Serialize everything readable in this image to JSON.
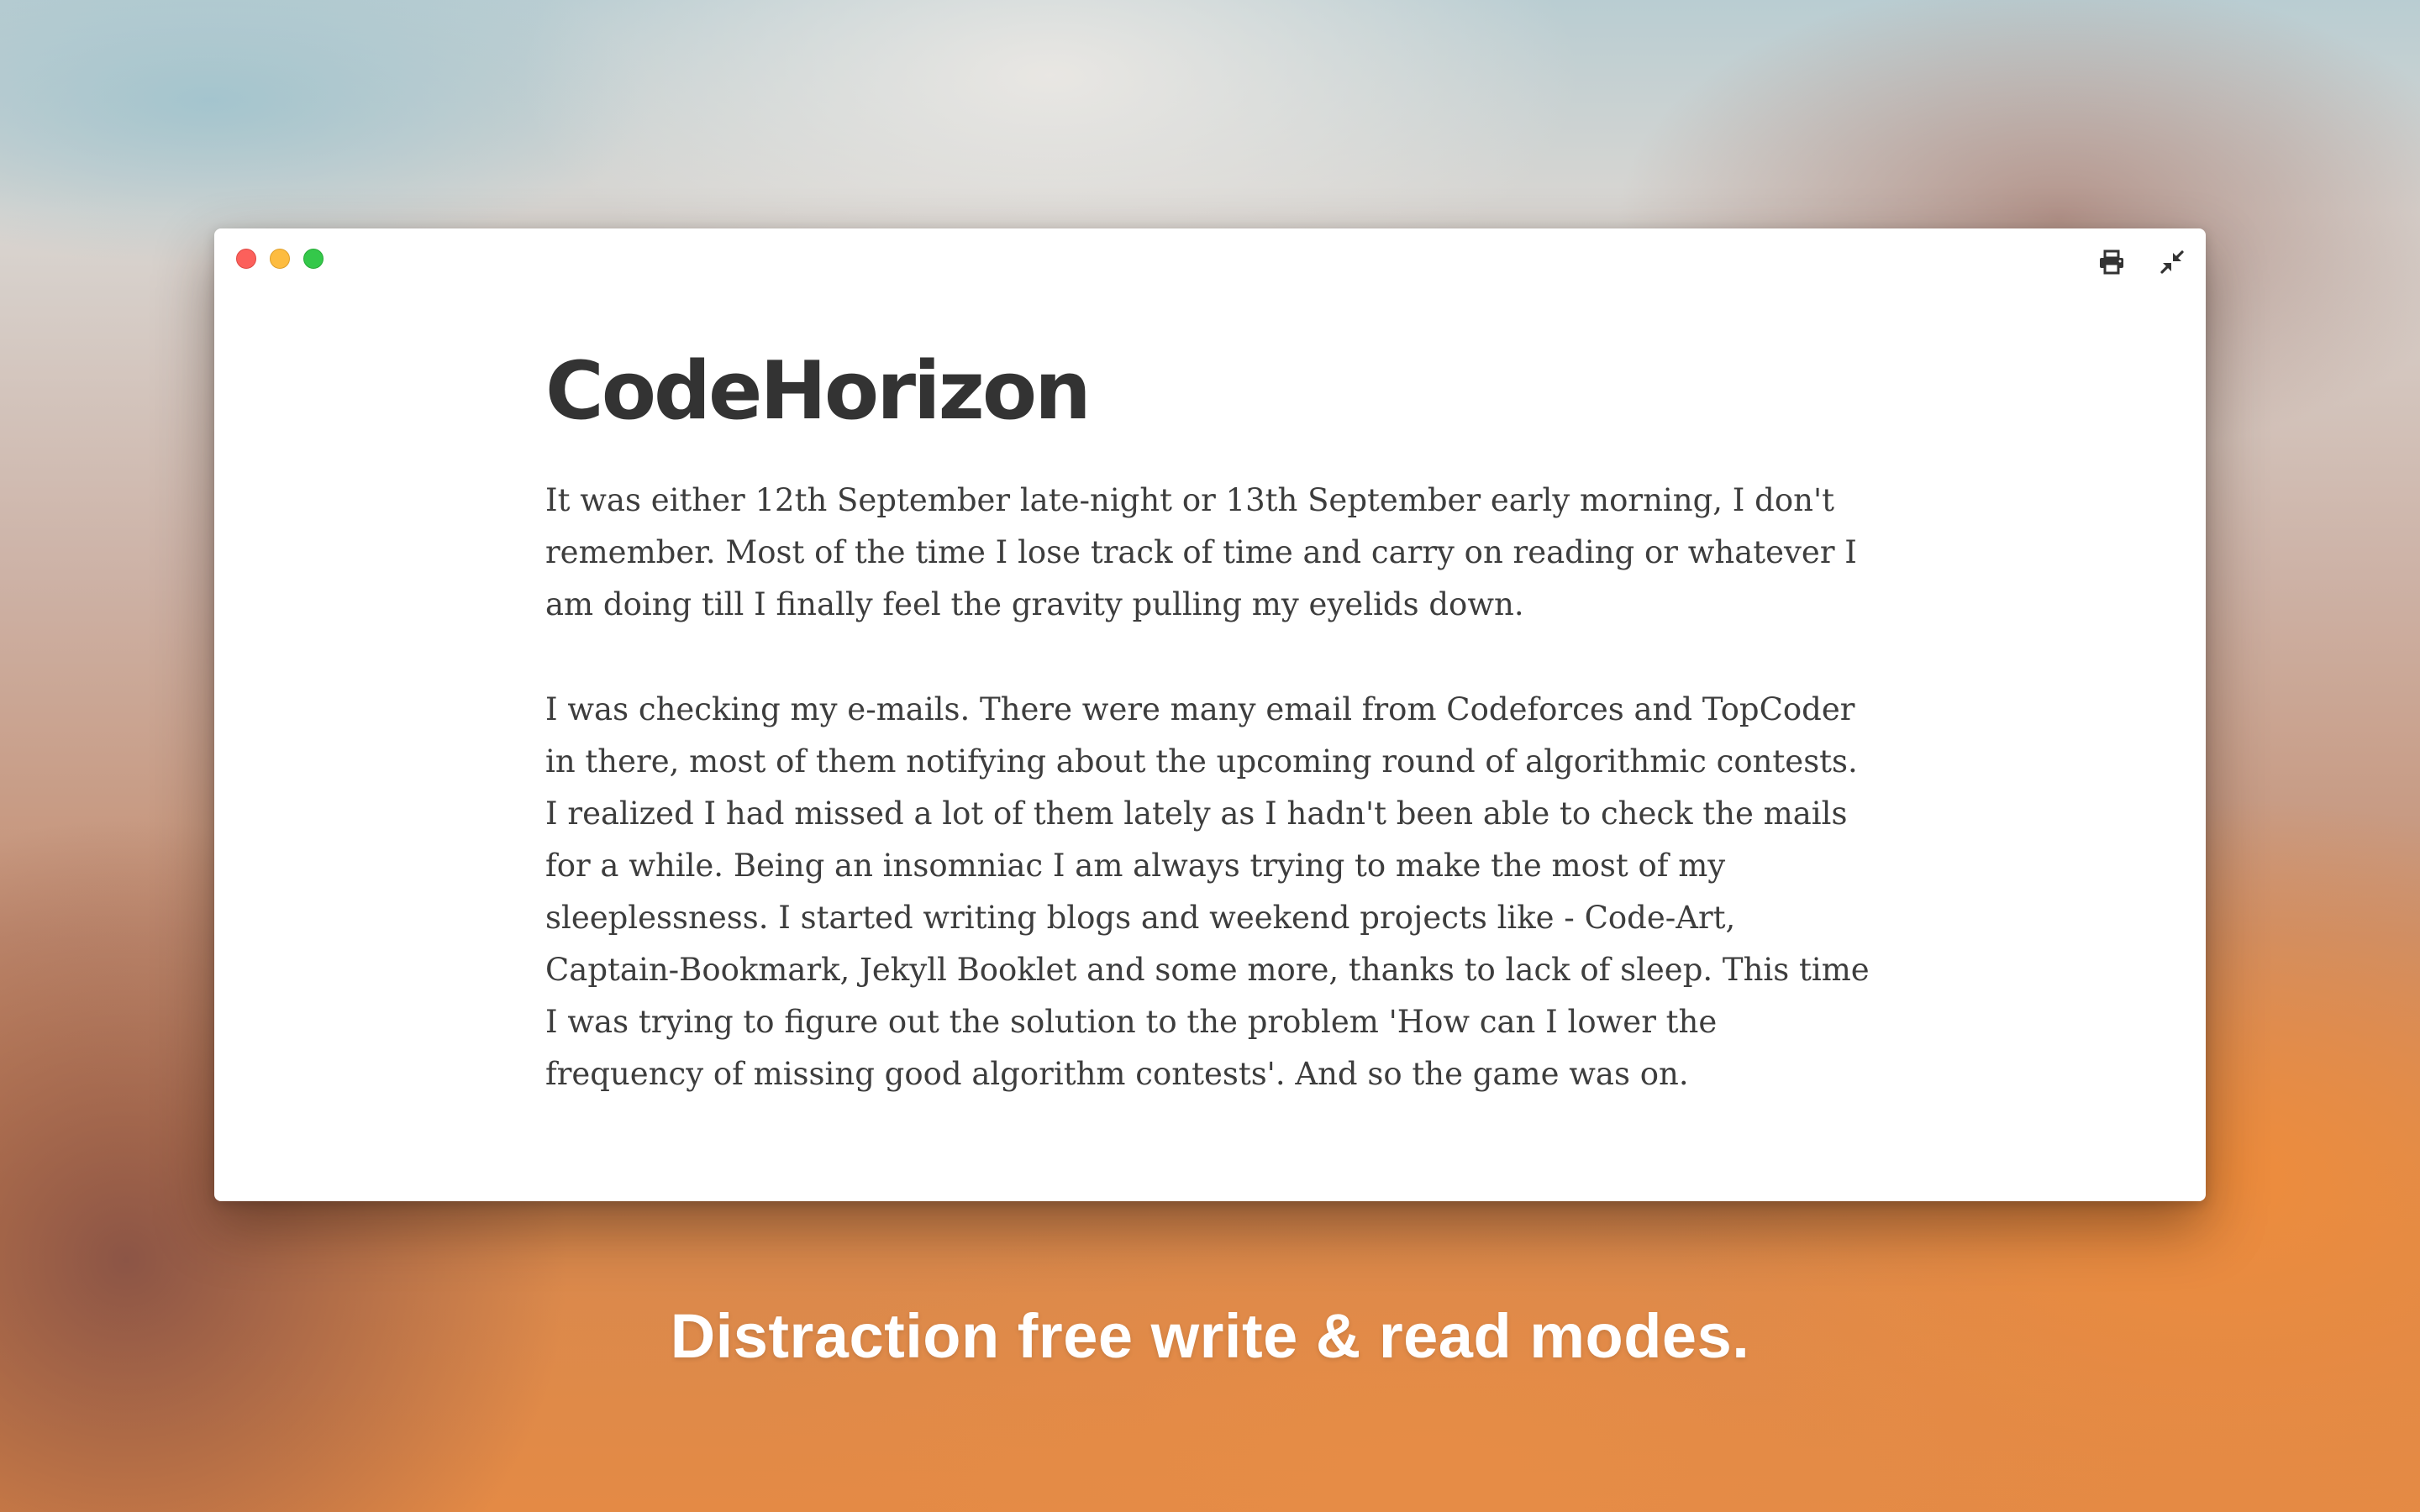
{
  "window": {
    "controls": [
      "close",
      "minimize",
      "maximize"
    ],
    "toolbar": {
      "print_icon": "printer-icon",
      "exit_fullscreen_icon": "collapse-arrows-icon"
    }
  },
  "document": {
    "title": "CodeHorizon",
    "paragraphs": [
      "It was either 12th September late-night or 13th September early morning, I don't remember. Most of the time I lose track of time and carry on reading or whatever I am doing till I finally feel the gravity pulling my eyelids down.",
      "I was checking my e-mails. There were many email from Codeforces and TopCoder in there, most of them notifying about the upcoming round of algorithmic contests. I realized I had missed a lot of them lately as I hadn't been able to check the mails for a while. Being an insomniac I am always trying to make the most of my sleeplessness. I started writing blogs and weekend projects like - Code-Art, Captain-Bookmark, Jekyll Booklet and some more, thanks to lack of sleep. This time I was trying to figure out the solution to the problem 'How can I lower the frequency of missing good algorithm contests'. And so the game was on."
    ]
  },
  "caption": "Distraction free write & read modes.",
  "colors": {
    "close": "#fc605b",
    "minimize": "#fdbc40",
    "maximize": "#34c84a",
    "title_text": "#333333",
    "body_text": "#3d3d3d"
  }
}
